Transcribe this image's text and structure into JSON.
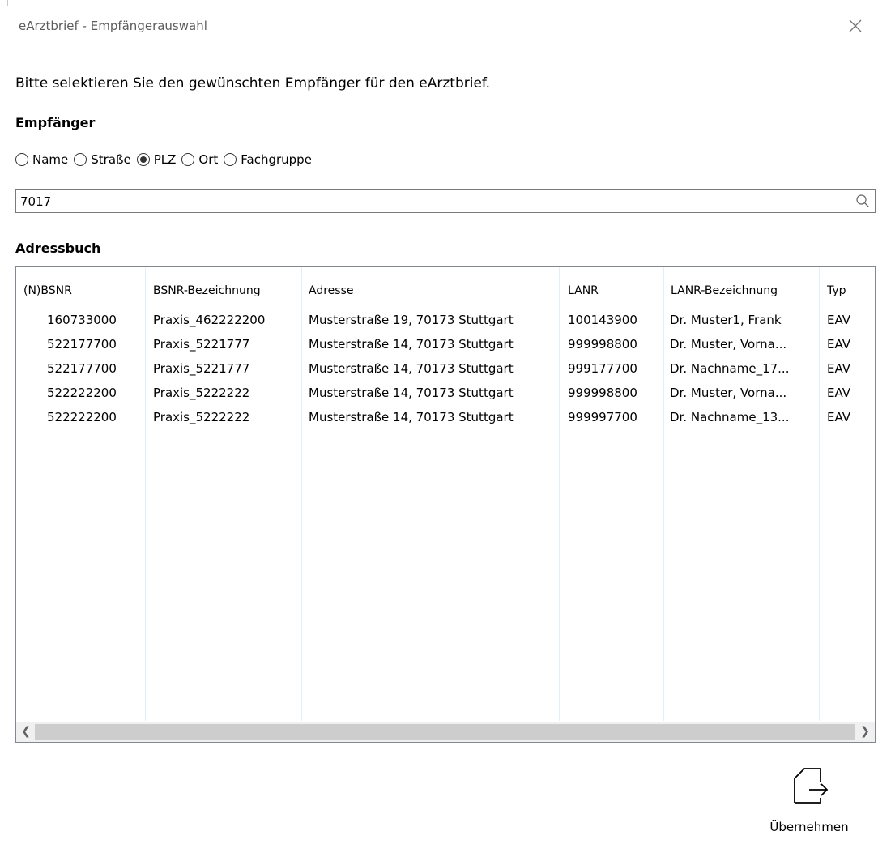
{
  "window": {
    "title": "eArztbrief - Empfängerauswahl"
  },
  "intro_text": "Bitte selektieren Sie den gewünschten Empfänger für den eArztbrief.",
  "empfaenger": {
    "heading": "Empfänger",
    "options": [
      {
        "label": "Name",
        "selected": false
      },
      {
        "label": "Straße",
        "selected": false
      },
      {
        "label": "PLZ",
        "selected": true
      },
      {
        "label": "Ort",
        "selected": false
      },
      {
        "label": "Fachgruppe",
        "selected": false
      }
    ],
    "search_value": "7017"
  },
  "adressbuch": {
    "heading": "Adressbuch",
    "columns": [
      "(N)BSNR",
      "BSNR-Bezeichnung",
      "Adresse",
      "LANR",
      "LANR-Bezeichnung",
      "Typ"
    ],
    "rows": [
      [
        "160733000",
        "Praxis_462222200",
        "Musterstraße 19, 70173 Stuttgart",
        "100143900",
        "Dr. Muster1, Frank",
        "EAV"
      ],
      [
        "522177700",
        "Praxis_5221777",
        "Musterstraße 14, 70173 Stuttgart",
        "999998800",
        "Dr. Muster, Vorna...",
        "EAV"
      ],
      [
        "522177700",
        "Praxis_5221777",
        "Musterstraße 14, 70173 Stuttgart",
        "999177700",
        "Dr. Nachname_17...",
        "EAV"
      ],
      [
        "522222200",
        "Praxis_5222222",
        "Musterstraße 14, 70173 Stuttgart",
        "999998800",
        "Dr. Muster, Vorna...",
        "EAV"
      ],
      [
        "522222200",
        "Praxis_5222222",
        "Musterstraße 14, 70173 Stuttgart",
        "999997700",
        "Dr. Nachname_13...",
        "EAV"
      ]
    ]
  },
  "actions": {
    "uebernehmen_label": "Übernehmen"
  },
  "icons": {
    "close": "close-icon",
    "search": "search-icon",
    "uebernehmen": "document-export-icon",
    "scroll_left": "chevron-left-icon",
    "scroll_right": "chevron-right-icon"
  }
}
